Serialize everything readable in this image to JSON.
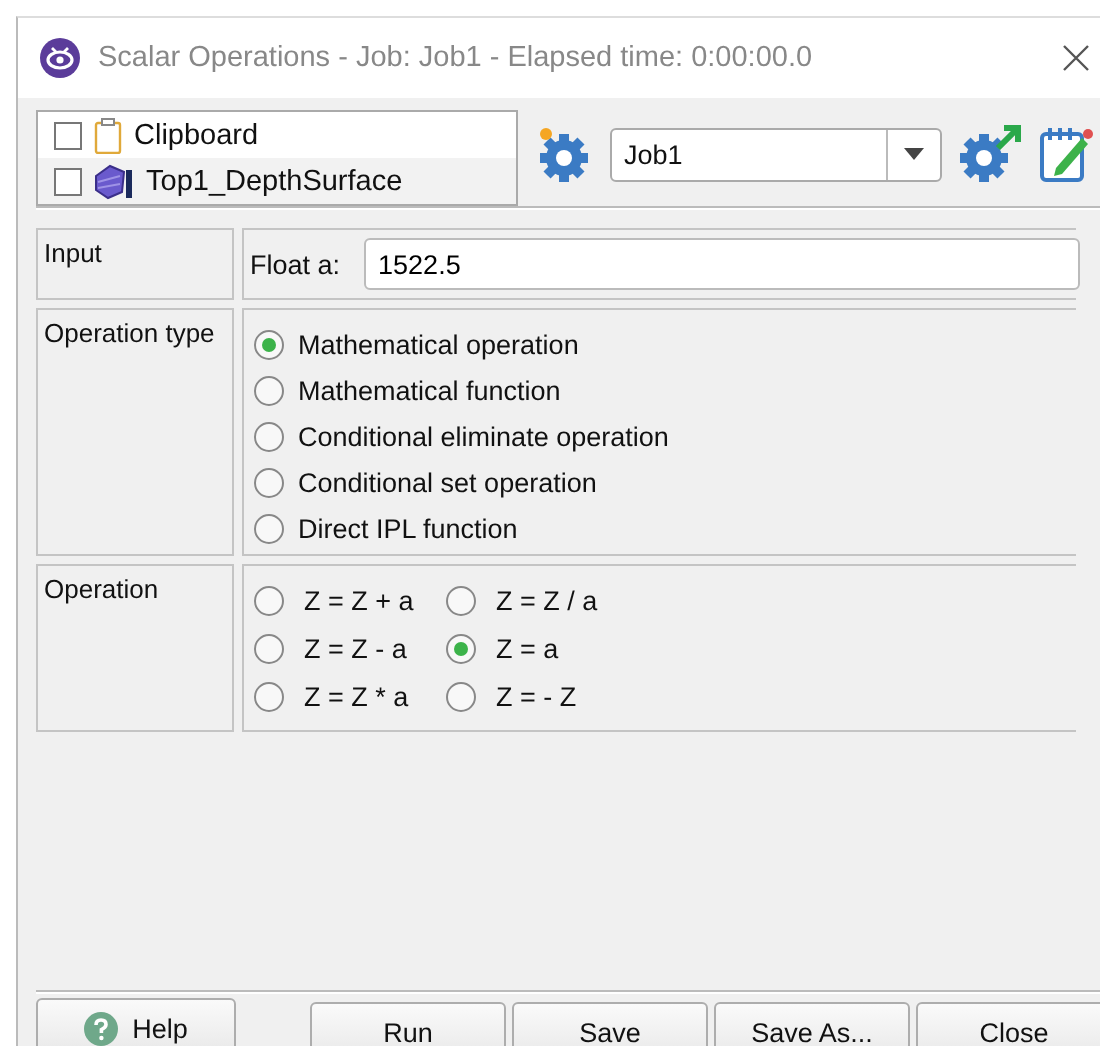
{
  "window": {
    "title": "Scalar Operations - Job: Job1 - Elapsed time: 0:00:00.0"
  },
  "sources": [
    {
      "label": "Clipboard",
      "kind": "clipboard",
      "checked": false
    },
    {
      "label": "Top1_DepthSurface",
      "kind": "surface",
      "checked": false
    }
  ],
  "job": {
    "value": "Job1"
  },
  "input": {
    "section": "Input",
    "label": "Float a:",
    "value": "1522.5"
  },
  "operation_type": {
    "section": "Operation type",
    "options": [
      {
        "label": "Mathematical operation",
        "selected": true
      },
      {
        "label": "Mathematical function",
        "selected": false
      },
      {
        "label": "Conditional eliminate operation",
        "selected": false
      },
      {
        "label": "Conditional set operation",
        "selected": false
      },
      {
        "label": "Direct IPL function",
        "selected": false
      }
    ]
  },
  "operation": {
    "section": "Operation",
    "options": [
      {
        "label": "Z = Z + a",
        "selected": false
      },
      {
        "label": "Z = Z / a",
        "selected": false
      },
      {
        "label": "Z = Z - a",
        "selected": false
      },
      {
        "label": "Z = a",
        "selected": true
      },
      {
        "label": "Z = Z * a",
        "selected": false
      },
      {
        "label": "Z = - Z",
        "selected": false
      }
    ]
  },
  "help_button": "Help",
  "buttons": [
    "Run",
    "Save",
    "Save As...",
    "Close"
  ]
}
